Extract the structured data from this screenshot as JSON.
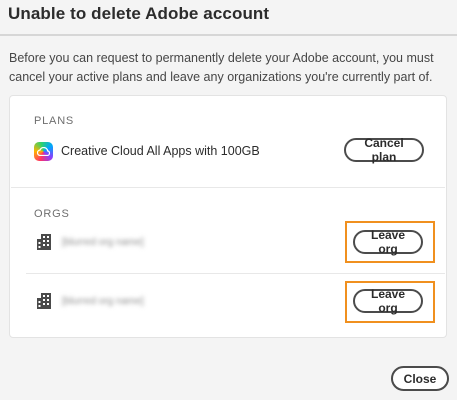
{
  "dialog": {
    "title": "Unable to delete Adobe account",
    "description": "Before you can request to permanently delete your Adobe account, you must cancel your active plans and leave any organizations you're currently part of."
  },
  "plans": {
    "label": "PLANS",
    "items": [
      {
        "name": "Creative Cloud All Apps with 100GB",
        "icon": "creative-cloud-icon",
        "action_label": "Cancel plan"
      }
    ]
  },
  "orgs": {
    "label": "ORGS",
    "items": [
      {
        "name": "[blurred org name]",
        "icon": "building-icon",
        "action_label": "Leave org",
        "highlighted": true
      },
      {
        "name": "[blurred org name]",
        "icon": "building-icon",
        "action_label": "Leave org",
        "highlighted": true
      }
    ]
  },
  "footer": {
    "close_label": "Close"
  },
  "colors": {
    "highlight": "#f0901f",
    "button_border": "#4b4b4b",
    "background": "#f4f4f4"
  }
}
